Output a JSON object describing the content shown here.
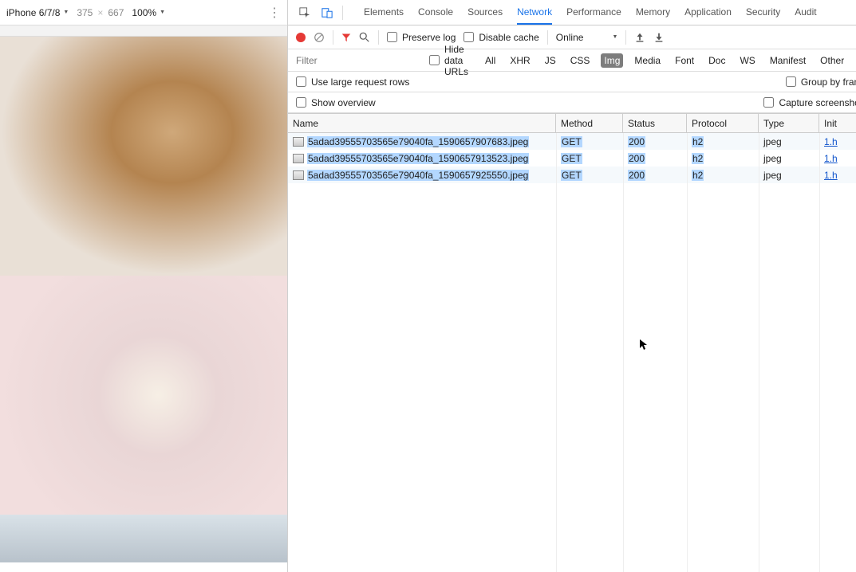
{
  "preview": {
    "device": "iPhone 6/7/8",
    "width": "375",
    "height": "667",
    "zoom": "100%"
  },
  "tabs": {
    "elements": "Elements",
    "console": "Console",
    "sources": "Sources",
    "network": "Network",
    "performance": "Performance",
    "memory": "Memory",
    "application": "Application",
    "security": "Security",
    "audits": "Audit"
  },
  "toolbar": {
    "preserve_log": "Preserve log",
    "disable_cache": "Disable cache",
    "online": "Online"
  },
  "filterRow": {
    "placeholder": "Filter",
    "hide_data_urls": "Hide data URLs",
    "types": {
      "all": "All",
      "xhr": "XHR",
      "js": "JS",
      "css": "CSS",
      "img": "Img",
      "media": "Media",
      "font": "Font",
      "doc": "Doc",
      "ws": "WS",
      "manifest": "Manifest",
      "other": "Other"
    }
  },
  "opts": {
    "use_large_rows": "Use large request rows",
    "group_by_frame": "Group by frame",
    "show_overview": "Show overview",
    "capture_screenshots": "Capture screenshots"
  },
  "columns": {
    "name": "Name",
    "method": "Method",
    "status": "Status",
    "protocol": "Protocol",
    "type": "Type",
    "initiator": "Init"
  },
  "rows": [
    {
      "name": "5adad39555703565e79040fa_1590657907683.jpeg",
      "method": "GET",
      "status": "200",
      "protocol": "h2",
      "type": "jpeg",
      "initiator": "1.h"
    },
    {
      "name": "5adad39555703565e79040fa_1590657913523.jpeg",
      "method": "GET",
      "status": "200",
      "protocol": "h2",
      "type": "jpeg",
      "initiator": "1.h"
    },
    {
      "name": "5adad39555703565e79040fa_1590657925550.jpeg",
      "method": "GET",
      "status": "200",
      "protocol": "h2",
      "type": "jpeg",
      "initiator": "1.h"
    }
  ]
}
